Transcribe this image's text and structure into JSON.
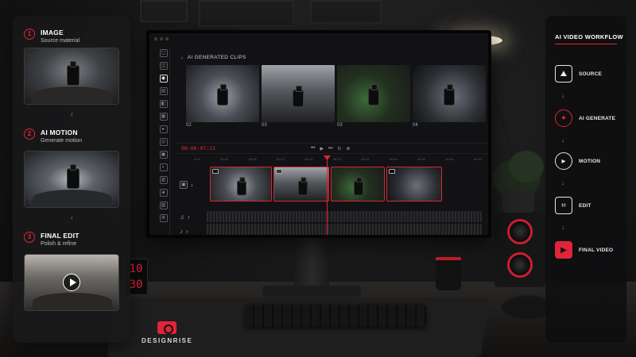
{
  "left_panel": {
    "steps": [
      {
        "number": "1",
        "title": "IMAGE",
        "subtitle": "Source material"
      },
      {
        "number": "2",
        "title": "AI MOTION",
        "subtitle": "Generate motion"
      },
      {
        "number": "3",
        "title": "FINAL EDIT",
        "subtitle": "Polish & refine"
      }
    ],
    "arrow": "↓"
  },
  "editor": {
    "section_label": "AI GENERATED CLIPS",
    "clips": [
      {
        "caption": "02"
      },
      {
        "caption": "03"
      },
      {
        "caption": "03"
      },
      {
        "caption": "04"
      }
    ],
    "timecode": "00:00:07:21",
    "ruler_ticks": [
      "0:00",
      "00:00",
      "00:08",
      "00:12",
      "00:16",
      "00:20",
      "00:24",
      "00:28",
      "00:32",
      "00:36",
      "00:40"
    ]
  },
  "desk": {
    "brand_name": "DESIGNRISE",
    "clock_hours": "10",
    "clock_minutes": "30"
  },
  "workflow": {
    "title": "AI VIDEO WORKFLOW",
    "items": [
      {
        "label": "SOURCE",
        "icon": "image-icon"
      },
      {
        "label": "AI GENERATE",
        "icon": "sparkle-icon"
      },
      {
        "label": "MOTION",
        "icon": "play-icon"
      },
      {
        "label": "EDIT",
        "icon": "crop-icon"
      },
      {
        "label": "FINAL VIDEO",
        "icon": "clapperboard-icon"
      }
    ],
    "arrow": "↓"
  },
  "colors": {
    "accent": "#e0243a",
    "panel": "#18181a",
    "screen": "#121214"
  }
}
